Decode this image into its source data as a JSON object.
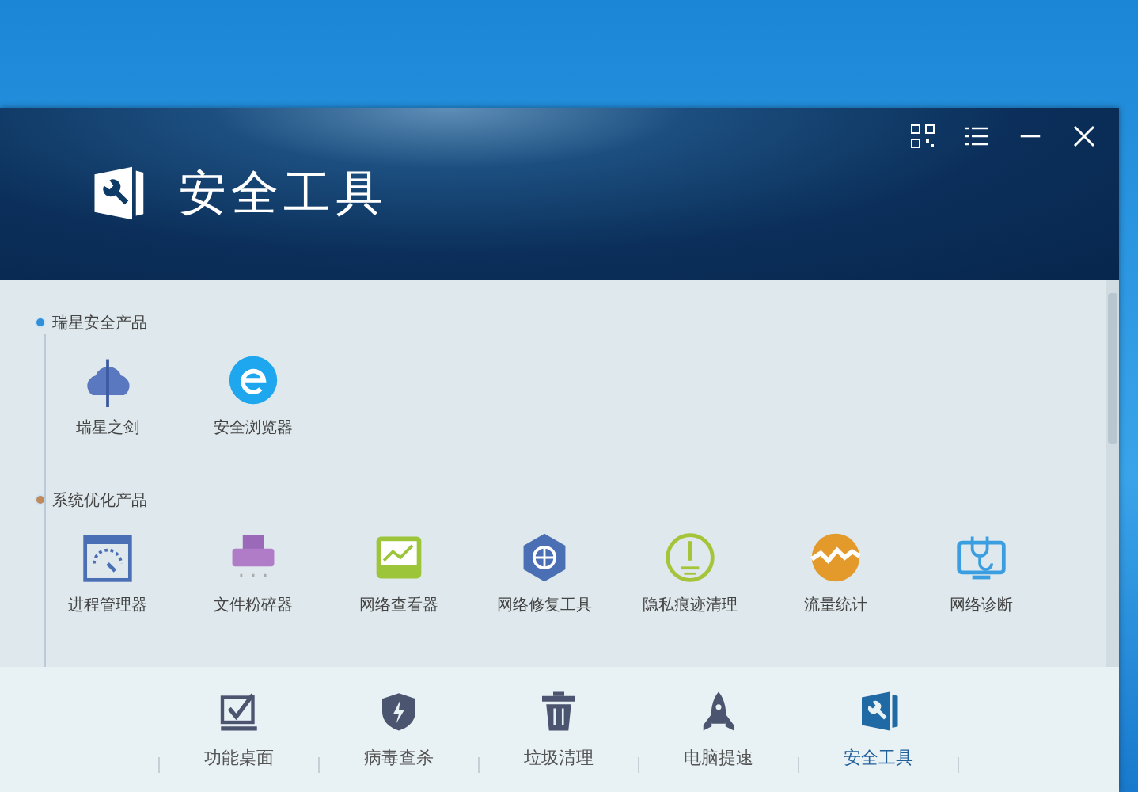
{
  "window": {
    "title": "安全工具"
  },
  "sections": [
    {
      "title": "瑞星安全产品",
      "items": [
        {
          "label": "瑞星之剑",
          "kind": "cloud-sword"
        },
        {
          "label": "安全浏览器",
          "kind": "browser"
        }
      ]
    },
    {
      "title": "系统优化产品",
      "items": [
        {
          "label": "进程管理器",
          "kind": "gauge"
        },
        {
          "label": "文件粉碎器",
          "kind": "shredder"
        },
        {
          "label": "网络查看器",
          "kind": "monitor"
        },
        {
          "label": "网络修复工具",
          "kind": "globe"
        },
        {
          "label": "隐私痕迹清理",
          "kind": "alert"
        },
        {
          "label": "流量统计",
          "kind": "traffic"
        },
        {
          "label": "网络诊断",
          "kind": "stethoscope"
        }
      ]
    }
  ],
  "nav": [
    {
      "label": "功能桌面",
      "kind": "check",
      "selected": false
    },
    {
      "label": "病毒查杀",
      "kind": "shield",
      "selected": false
    },
    {
      "label": "垃圾清理",
      "kind": "trash",
      "selected": false
    },
    {
      "label": "电脑提速",
      "kind": "rocket",
      "selected": false
    },
    {
      "label": "安全工具",
      "kind": "tools",
      "selected": true
    }
  ]
}
